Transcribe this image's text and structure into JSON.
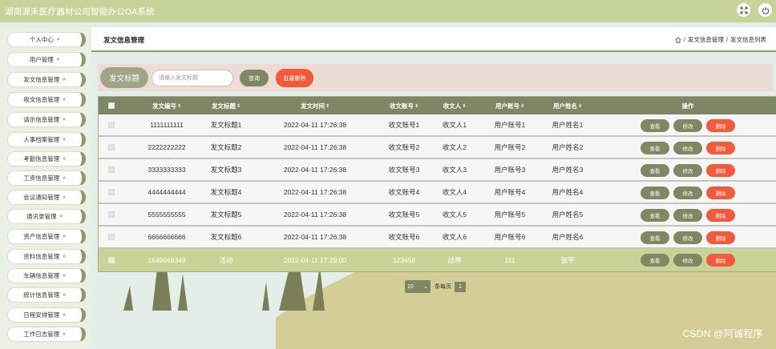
{
  "app": {
    "title": "湖南源禾医疗器材公司智能办公OA系统"
  },
  "sidebar": {
    "items": [
      {
        "label": "个人中心"
      },
      {
        "label": "用户管理"
      },
      {
        "label": "发文信息管理"
      },
      {
        "label": "收文信息管理"
      },
      {
        "label": "请示信息管理"
      },
      {
        "label": "人事档案管理"
      },
      {
        "label": "考勤信息管理"
      },
      {
        "label": "工资信息管理"
      },
      {
        "label": "会议通知管理"
      },
      {
        "label": "通讯录管理"
      },
      {
        "label": "资产信息管理"
      },
      {
        "label": "资料信息管理"
      },
      {
        "label": "车辆信息管理"
      },
      {
        "label": "统计信息管理"
      },
      {
        "label": "日程安排管理"
      },
      {
        "label": "工作日志管理"
      }
    ]
  },
  "header": {
    "page_title": "发文信息管理",
    "breadcrumb": {
      "section": "发文信息管理",
      "page": "发文信息列表",
      "sep": "/"
    }
  },
  "search": {
    "label": "发文标题",
    "placeholder": "请输入发文标题",
    "query_label": "查询",
    "batch_delete_label": "批量删除"
  },
  "table": {
    "columns": [
      "发文编号",
      "发文标题",
      "发文时间",
      "收文账号",
      "收文人",
      "用户账号",
      "用户姓名",
      "操作"
    ],
    "sort_glyph": "⇕",
    "actions": {
      "view": "查看",
      "edit": "修改",
      "delete": "删除"
    },
    "rows": [
      {
        "id": "1111111111",
        "title": "发文标题1",
        "time": "2022-04-11 17:26:38",
        "recv_account": "收文账号1",
        "receiver": "收文人1",
        "user_account": "用户账号1",
        "user_name": "用户姓名1"
      },
      {
        "id": "2222222222",
        "title": "发文标题2",
        "time": "2022-04-11 17:26:38",
        "recv_account": "收文账号2",
        "receiver": "收文人2",
        "user_account": "用户账号2",
        "user_name": "用户姓名2"
      },
      {
        "id": "3333333333",
        "title": "发文标题3",
        "time": "2022-04-11 17:26:38",
        "recv_account": "收文账号3",
        "receiver": "收文人3",
        "user_account": "用户账号3",
        "user_name": "用户姓名3"
      },
      {
        "id": "4444444444",
        "title": "发文标题4",
        "time": "2022-04-11 17:26:38",
        "recv_account": "收文账号4",
        "receiver": "收文人4",
        "user_account": "用户账号4",
        "user_name": "用户姓名4"
      },
      {
        "id": "5555555555",
        "title": "发文标题5",
        "time": "2022-04-11 17:26:38",
        "recv_account": "收文账号5",
        "receiver": "收文人5",
        "user_account": "用户账号5",
        "user_name": "用户姓名5"
      },
      {
        "id": "6666666666",
        "title": "发文标题6",
        "time": "2022-04-11 17:26:38",
        "recv_account": "收文账号6",
        "receiver": "收文人6",
        "user_account": "用户账号6",
        "user_name": "用户姓名6"
      },
      {
        "id": "1649669349",
        "title": "活动",
        "time": "2022-04-11 17:29:00",
        "recv_account": "123456",
        "receiver": "战神",
        "user_account": "111",
        "user_name": "张宇"
      }
    ]
  },
  "pagination": {
    "page_size": "10",
    "per_page_label": "条每页",
    "current_page": "1"
  },
  "watermark": "CSDN @阿诚程序",
  "colors": {
    "accent": "#7f8862",
    "danger": "#f25a3a",
    "topbar": "#c6d49a",
    "highlight_row": "#c8d496"
  }
}
